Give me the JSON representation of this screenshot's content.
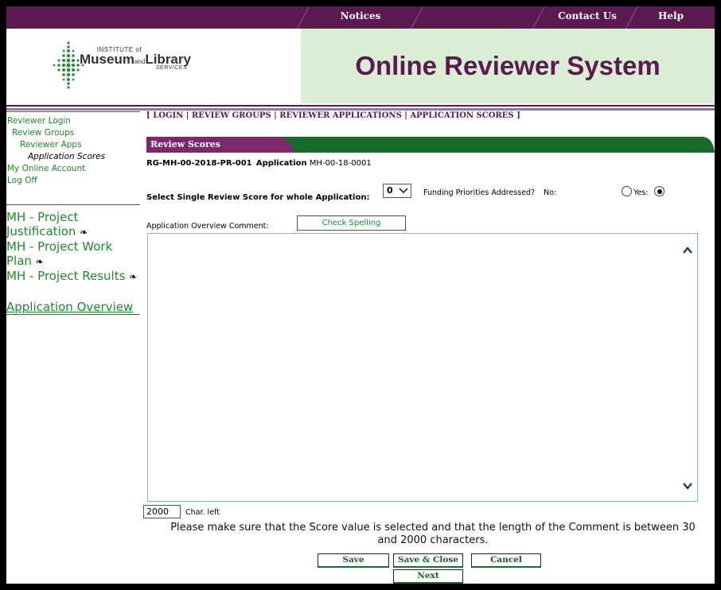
{
  "nav": {
    "tabs": [
      "Notices",
      "Contact Us",
      "Help"
    ]
  },
  "header": {
    "logo_small": "INSTITUTE of",
    "logo_museum": "Museum",
    "logo_and": "and",
    "logo_library": "Library",
    "logo_services": "SERVICES",
    "site_title": "Online Reviewer System"
  },
  "sidebar": {
    "links": [
      "Reviewer Login",
      "Review Groups",
      "Reviewer Apps",
      "Application Scores",
      "My Online Account",
      "Log Off"
    ],
    "sections": [
      "MH - Project Justification",
      "MH - Project Work Plan",
      "MH - Project Results"
    ],
    "overview": "Application Overview"
  },
  "breadcrumb": {
    "open": "[",
    "items": [
      "LOGIN",
      "REVIEW GROUPS",
      "REVIEWER APPLICATIONS",
      "APPLICATION SCORES"
    ],
    "close": "]"
  },
  "section_title": "Review Scores",
  "application": {
    "group_id": "RG-MH-00-2018-PR-001",
    "label": "Application",
    "app_id": "MH-00-18-0001"
  },
  "score": {
    "label": "Select Single Review Score for whole Application:",
    "value": "0",
    "funding_label": "Funding Priorities Addressed?",
    "no_label": "No:",
    "yes_label": "Yes:",
    "selected": "Yes"
  },
  "comment": {
    "label": "Application Overview Comment:",
    "spell_button": "Check Spelling",
    "text": "",
    "chars_left": "2000",
    "chars_left_label": "Char. left"
  },
  "notice": "Please make sure that the Score value is selected and that the length of the Comment is between 30 and 2000 characters.",
  "buttons": {
    "save": "Save",
    "save_close": "Save & Close",
    "cancel": "Cancel",
    "next": "Next"
  },
  "colors": {
    "brand_purple": "#5a1a50",
    "brand_green": "#1c8c2c",
    "header_bg": "#dcedd5"
  }
}
